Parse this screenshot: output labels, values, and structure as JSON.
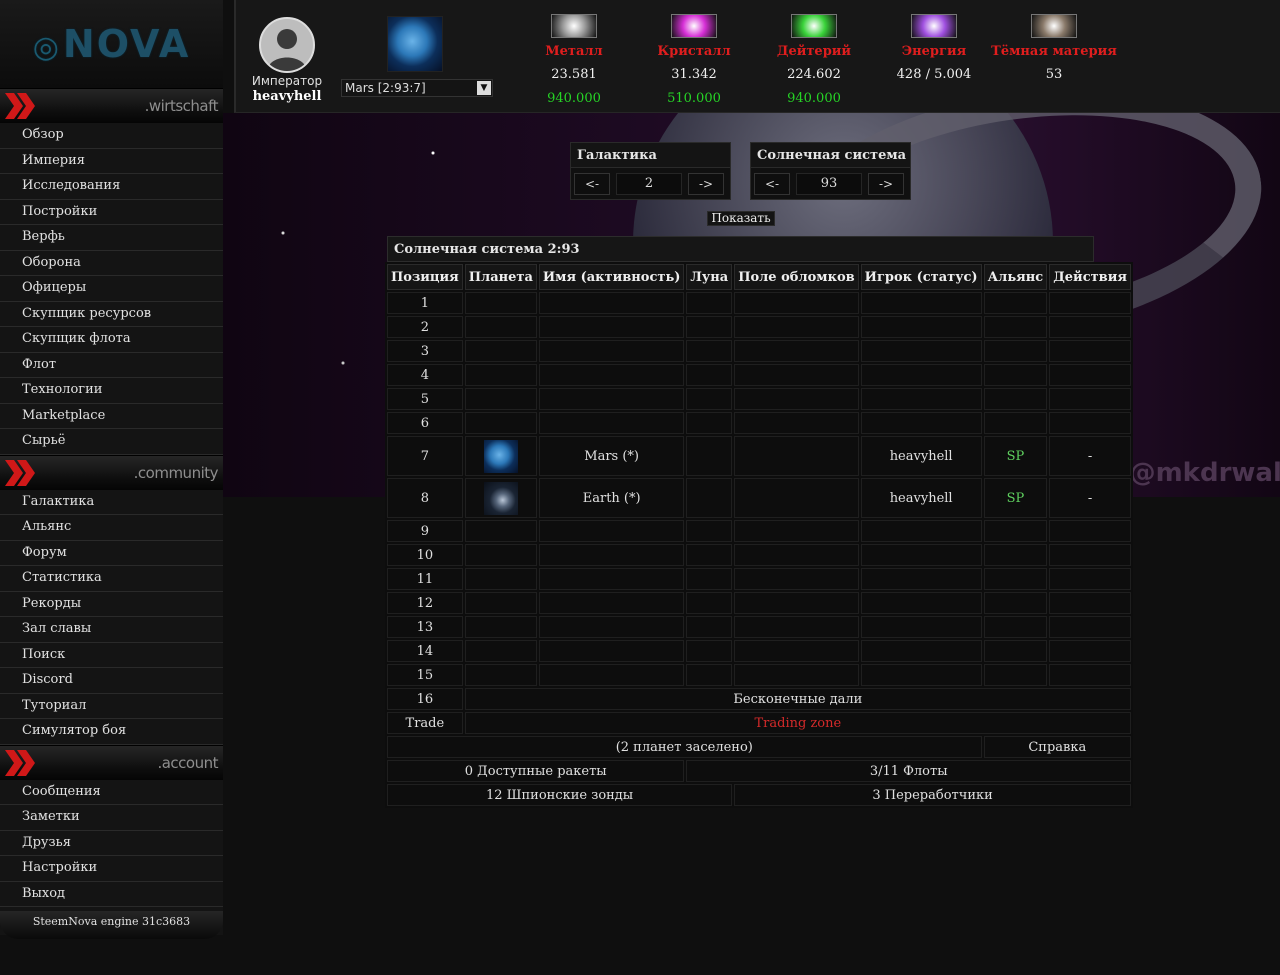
{
  "logo": {
    "text": "NOVA"
  },
  "sidebar": {
    "sections": [
      {
        "title": ".wirtschaft",
        "items": [
          "Обзор",
          "Империя",
          "Исследования",
          "Постройки",
          "Верфь",
          "Оборона",
          "Офицеры",
          "Скупщик ресурсов",
          "Скупщик флота",
          "Флот",
          "Технологии",
          "Marketplace",
          "Сырьё"
        ]
      },
      {
        "title": ".community",
        "items": [
          "Галактика",
          "Альянс",
          "Форум",
          "Статистика",
          "Рекорды",
          "Зал славы",
          "Поиск",
          "Discord",
          "Туториал",
          "Симулятор боя"
        ]
      },
      {
        "title": ".account",
        "items": [
          "Сообщения",
          "Заметки",
          "Друзья",
          "Настройки",
          "Выход"
        ]
      }
    ],
    "engine": "SteemNova engine 31c3683"
  },
  "header": {
    "emperor_title": "Император",
    "emperor_name": "heavyhell",
    "planet_select": "Mars [2:93:7]",
    "resources": [
      {
        "name": "Металл",
        "amount": "23.581",
        "production": "940.000",
        "icon": "metal-icon",
        "color": "#9a9a9a"
      },
      {
        "name": "Кристалл",
        "amount": "31.342",
        "production": "510.000",
        "icon": "crystal-icon",
        "color": "#d62fd6"
      },
      {
        "name": "Дейтерий",
        "amount": "224.602",
        "production": "940.000",
        "icon": "deuterium-icon",
        "color": "#3ad33a"
      },
      {
        "name": "Энергия",
        "amount": "428 / 5.004",
        "production": "",
        "icon": "energy-icon",
        "color": "#a050e0"
      },
      {
        "name": "Тёмная материя",
        "amount": "53",
        "production": "",
        "icon": "dark-matter-icon",
        "color": "#8a7a6a"
      }
    ]
  },
  "background": {
    "watermark": "m/@mkdrwal"
  },
  "navigator": {
    "galaxy": {
      "title": "Галактика",
      "prev": "<-",
      "value": "2",
      "next": "->"
    },
    "system": {
      "title": "Солнечная система",
      "prev": "<-",
      "value": "93",
      "next": "->"
    },
    "show_button": "Показать"
  },
  "system_table": {
    "caption": "Солнечная система 2:93",
    "headers": [
      "Позиция",
      "Планета",
      "Имя (активность)",
      "Луна",
      "Поле обломков",
      "Игрок (статус)",
      "Альянс",
      "Действия"
    ],
    "rows": [
      {
        "pos": "1",
        "name": "",
        "player": "",
        "ally": "",
        "action": ""
      },
      {
        "pos": "2",
        "name": "",
        "player": "",
        "ally": "",
        "action": ""
      },
      {
        "pos": "3",
        "name": "",
        "player": "",
        "ally": "",
        "action": ""
      },
      {
        "pos": "4",
        "name": "",
        "player": "",
        "ally": "",
        "action": ""
      },
      {
        "pos": "5",
        "name": "",
        "player": "",
        "ally": "",
        "action": ""
      },
      {
        "pos": "6",
        "name": "",
        "player": "",
        "ally": "",
        "action": ""
      },
      {
        "pos": "7",
        "name": "Mars (*)",
        "player": "heavyhell",
        "ally": "SP",
        "action": "-",
        "planet": "mars"
      },
      {
        "pos": "8",
        "name": "Earth (*)",
        "player": "heavyhell",
        "ally": "SP",
        "action": "-",
        "planet": "earth"
      },
      {
        "pos": "9",
        "name": "",
        "player": "",
        "ally": "",
        "action": ""
      },
      {
        "pos": "10",
        "name": "",
        "player": "",
        "ally": "",
        "action": ""
      },
      {
        "pos": "11",
        "name": "",
        "player": "",
        "ally": "",
        "action": ""
      },
      {
        "pos": "12",
        "name": "",
        "player": "",
        "ally": "",
        "action": ""
      },
      {
        "pos": "13",
        "name": "",
        "player": "",
        "ally": "",
        "action": ""
      },
      {
        "pos": "14",
        "name": "",
        "player": "",
        "ally": "",
        "action": ""
      },
      {
        "pos": "15",
        "name": "",
        "player": "",
        "ally": "",
        "action": ""
      }
    ],
    "row16": {
      "pos": "16",
      "text": "Бесконечные дали"
    },
    "trade": {
      "pos": "Trade",
      "text": "Trading zone"
    },
    "colonized": "(2 планет заселено)",
    "help": "Справка",
    "missiles": "0 Доступные ракеты",
    "fleets": "3/11 Флоты",
    "probes": "12 Шпионские зонды",
    "recyclers": "3 Переработчики"
  }
}
